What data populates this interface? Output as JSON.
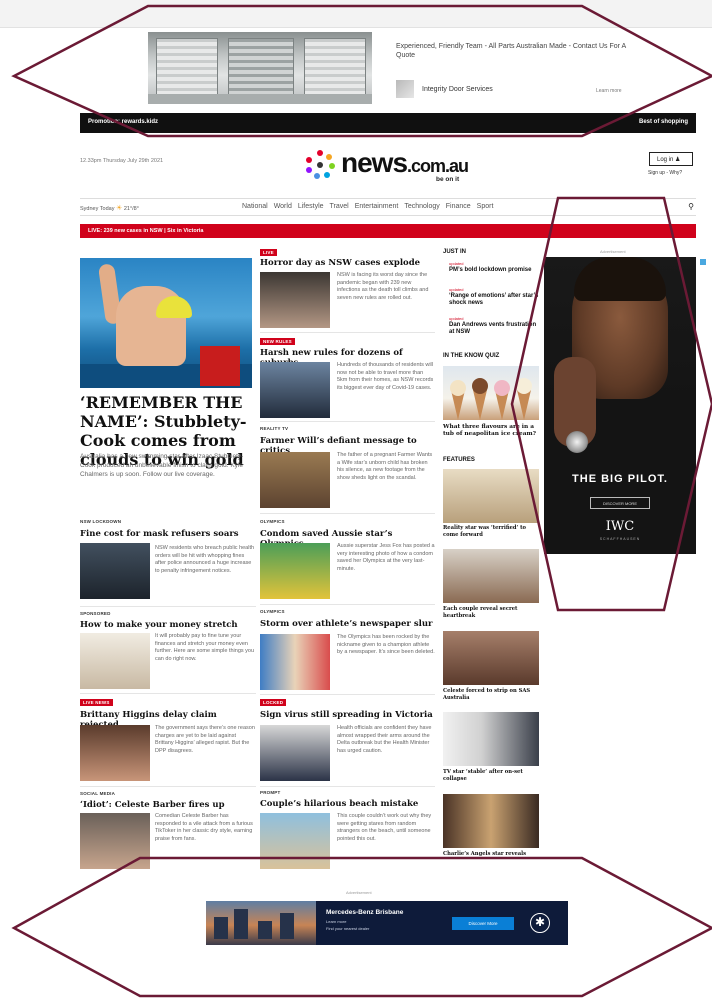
{
  "top_ad": {
    "headline": "Experienced, Friendly Team - All Parts Australian Made - Contact Us For A Quote",
    "brand": "Integrity Door Services",
    "learn_more": "Learn more"
  },
  "promo_bar": {
    "left": "Promotion: rewards.kidz",
    "right": "Best of shopping"
  },
  "masthead": {
    "date": "12.33pm Thursday July 29th 2021",
    "logo_name": "news",
    "logo_tld": ".com.au",
    "tagline": "be on it",
    "login": "Log in",
    "signup": "Sign up - Why?"
  },
  "nav": {
    "location": "Sydney",
    "today": "Today",
    "temp": "21°/8°",
    "items": [
      "National",
      "World",
      "Lifestyle",
      "Travel",
      "Entertainment",
      "Technology",
      "Finance",
      "Sport"
    ],
    "search": "Search"
  },
  "alert": "LIVE: 239 new cases in NSW | Six in Victoria",
  "lead": {
    "headline": "‘REMEMBER THE NAME’: Stubblety-Cook comes from clouds to win gold",
    "summary": "Australia has a new swimming star after Izaac Stubblety-Cook produced an unbelievable finish to claim gold. Kyle Chalmers is up soon. Follow our live coverage."
  },
  "middle_stories": [
    {
      "kicker": "LIVE",
      "headline": "Horror day as NSW cases explode",
      "summary": "NSW is facing its worst day since the pandemic began with 239 new infections as the death toll climbs and seven new rules are rolled out."
    },
    {
      "kicker": "NEW RULES",
      "headline": "Harsh new rules for dozens of suburbs",
      "summary": "Hundreds of thousands of residents will now not be able to travel more than 5km from their homes, as NSW records its biggest ever day of Covid-19 cases."
    },
    {
      "kicker": "REALITY TV",
      "headline": "Farmer Will’s defiant message to critics",
      "summary": "The father of a pregnant Farmer Wants a Wife star’s unborn child has broken his silence, as new footage from the show sheds light on the scandal."
    },
    {
      "kicker": "OLYMPICS",
      "headline": "Condom saved Aussie star’s Olympics",
      "summary": "Aussie superstar Jess Fox has posted a very interesting photo of how a condom saved her Olympics at the very last-minute."
    },
    {
      "kicker": "OLYMPICS",
      "headline": "Storm over athlete’s newspaper slur",
      "summary": "The Olympics has been rocked by the nickname given to a champion athlete by a newspaper. It’s since been deleted."
    },
    {
      "kicker": "LOCKED",
      "headline": "Sign virus still spreading in Victoria",
      "summary": "Health officials are confident they have almost wrapped their arms around the Delta outbreak but the Health Minister has urged caution."
    },
    {
      "kicker": "PROMPT",
      "headline": "Couple’s hilarious beach mistake",
      "summary": "This couple couldn’t work out why they were getting stares from random strangers on the beach, until someone pointed this out."
    }
  ],
  "left_stories": [
    {
      "kicker": "NSW LOCKDOWN",
      "headline": "Fine cost for mask refusers soars",
      "summary": "NSW residents who breach public health orders will be hit with whopping fines after police announced a huge increase to penalty infringement notices."
    },
    {
      "kicker": "SPONSORED",
      "headline": "How to make your money stretch",
      "summary": "It will probably pay to fine tune your finances and stretch your money even further. Here are some simple things you can do right now."
    },
    {
      "kicker": "LIVE NEWS",
      "headline": "Brittany Higgins delay claim rejected",
      "summary": "The government says there’s one reason charges are yet to be laid against Brittany Higgins’ alleged rapist. But the DPP disagrees."
    },
    {
      "kicker": "SOCIAL MEDIA",
      "headline": "‘Idiot’: Celeste Barber fires up",
      "summary": "Comedian Celeste Barber has responded to a vile attack from a furious TikToker in her classic dry style, earning praise from fans."
    }
  ],
  "just_in": {
    "title": "JUST IN",
    "items": [
      {
        "tag": "updated",
        "headline": "PM’s bold lockdown promise"
      },
      {
        "tag": "updated",
        "headline": "‘Range of emotions’ after star’s shock news"
      },
      {
        "tag": "updated",
        "headline": "Dan Andrews vents frustration at NSW"
      }
    ]
  },
  "quiz": {
    "title": "IN THE KNOW QUIZ",
    "caption": "What three flavours are in a tub of neapolitan ice cream?"
  },
  "features": {
    "title": "FEATURES",
    "items": [
      "Reality star was ‘terrified’ to come forward",
      "Each couple reveal secret heartbreak",
      "Celeste forced to strip on SAS Australia",
      "TV star ‘stable’ after on-set collapse",
      "Charlie’s Angels star reveals"
    ]
  },
  "iwc_ad": {
    "label": "Advertisement",
    "title": "THE BIG PILOT.",
    "button": "DISCOVER MORE",
    "logo": "IWC",
    "sub": "SCHAFFHAUSEN"
  },
  "bottom_ad": {
    "label": "Advertisement",
    "title": "Mercedes-Benz Brisbane",
    "line1": "Learn more",
    "line2": "Find your nearest dealer",
    "button": "Discover More"
  },
  "colors": {
    "accent_red": "#d0021b",
    "annotation": "#6b1a35"
  }
}
